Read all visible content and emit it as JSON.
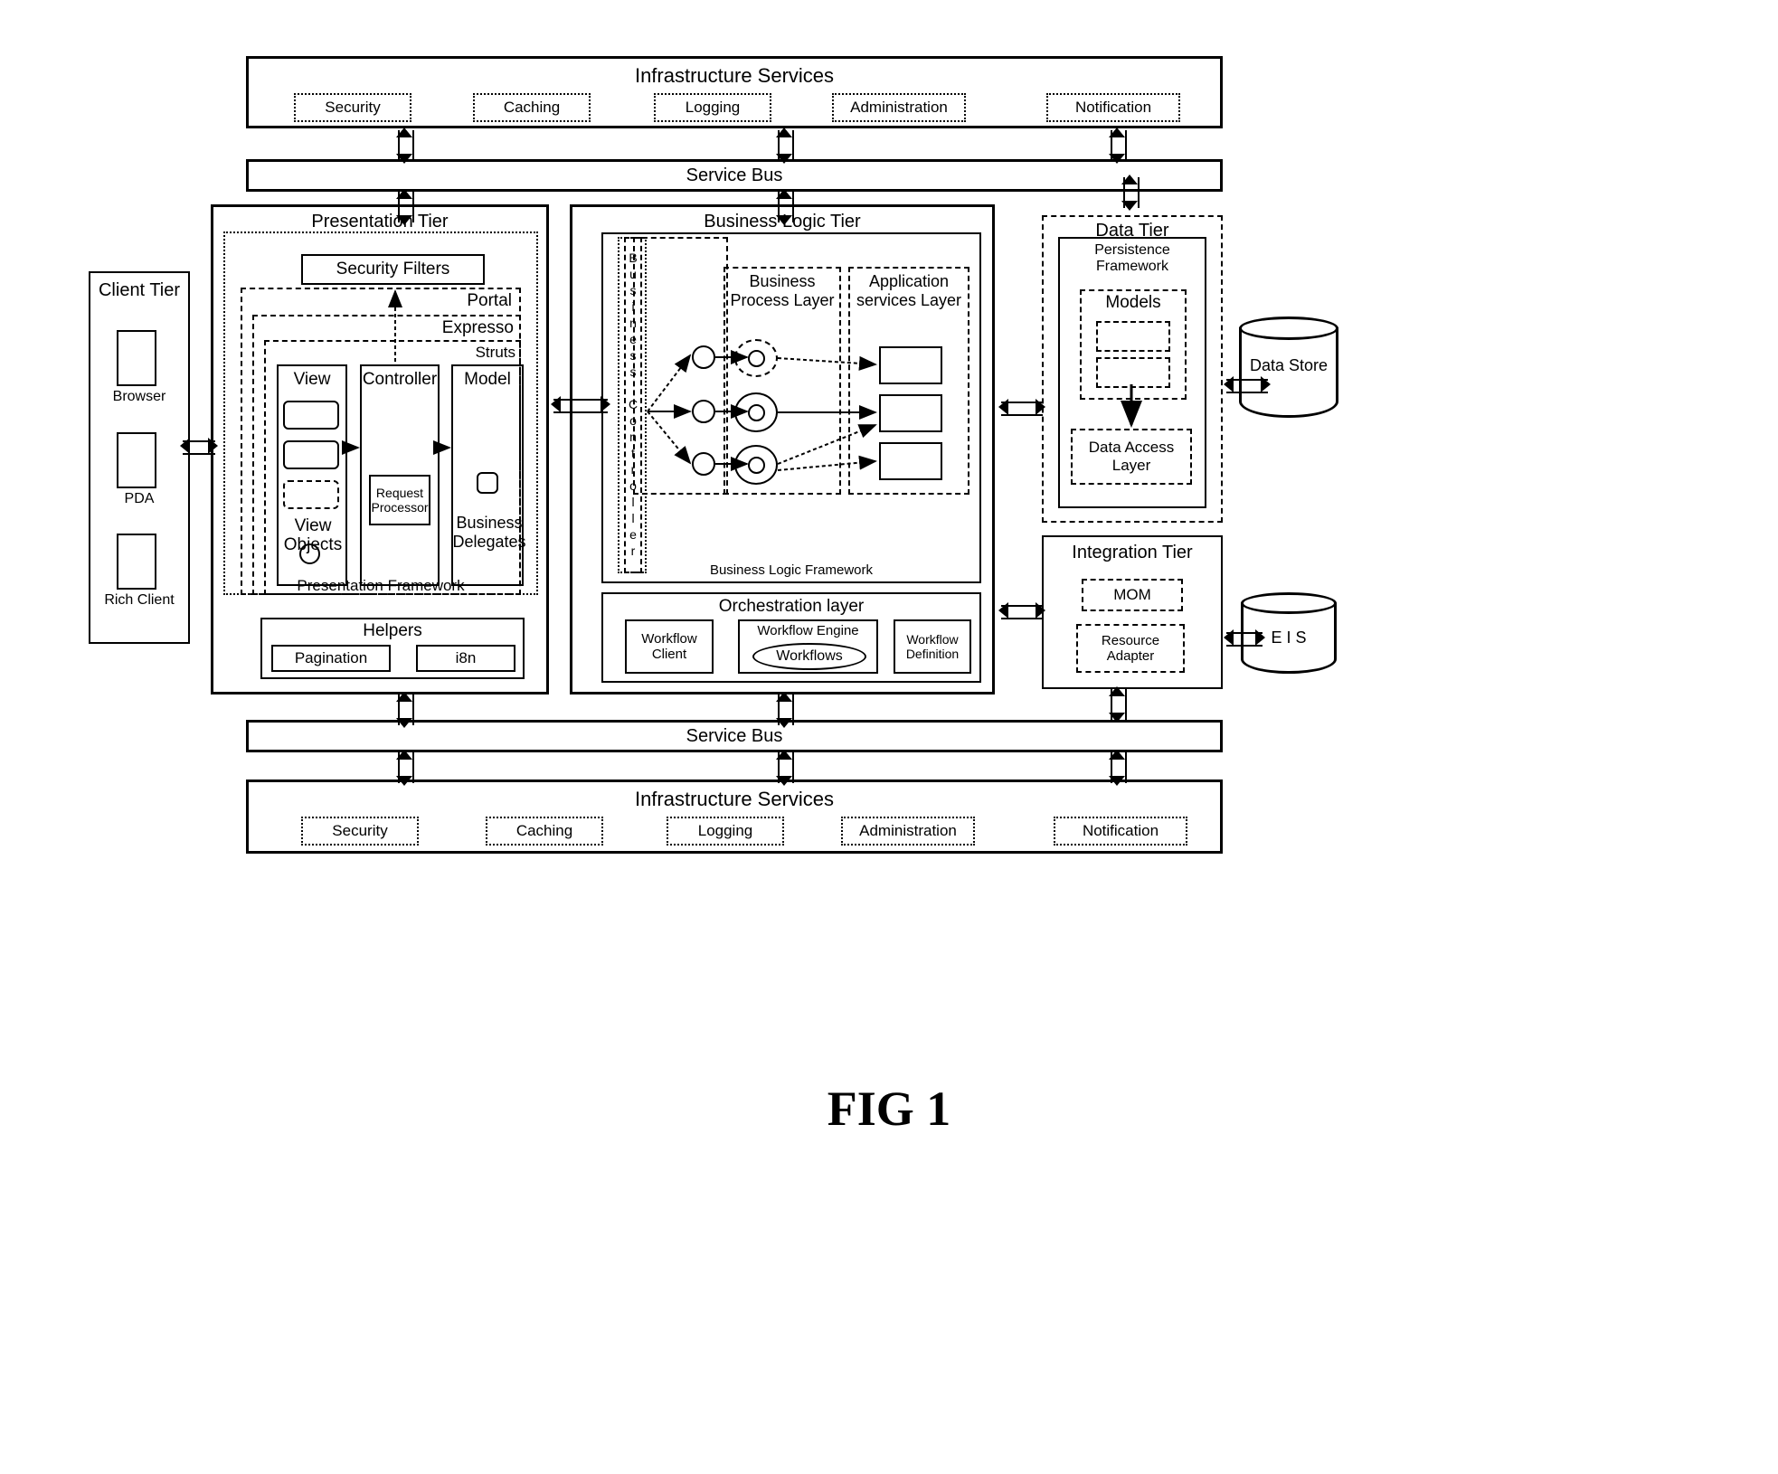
{
  "figure": {
    "caption": "FIG 1"
  },
  "infra_top": {
    "title": "Infrastructure Services",
    "items": [
      "Security",
      "Caching",
      "Logging",
      "Administration",
      "Notification"
    ]
  },
  "service_bus_top": {
    "label": "Service Bus"
  },
  "service_bus_bottom": {
    "label": "Service Bus"
  },
  "infra_bottom": {
    "title": "Infrastructure Services",
    "items": [
      "Security",
      "Caching",
      "Logging",
      "Administration",
      "Notification"
    ]
  },
  "client_tier": {
    "title": "Client Tier",
    "items": [
      "Browser",
      "PDA",
      "Rich Client"
    ]
  },
  "presentation_tier": {
    "title": "Presentation Tier",
    "security_filters": "Security Filters",
    "frameworks": [
      "Portal",
      "Expresso",
      "Struts"
    ],
    "framework_label": "Presentation Framework",
    "view": {
      "title": "View",
      "sub_title": "View Objects",
      "boxes": [
        "",
        "",
        ""
      ]
    },
    "controller": {
      "title": "Controller",
      "request_processor": "Request Processor"
    },
    "model": {
      "title": "Model",
      "business_delegates": "Business Delegates"
    },
    "helpers": {
      "title": "Helpers",
      "items": [
        "Pagination",
        "i8n"
      ]
    }
  },
  "business_logic_tier": {
    "title": "Business Logic Tier",
    "framework_label": "Business Logic Framework",
    "business_controller": "Business Controller",
    "business_process_layer": "Business Process Layer",
    "application_services_layer": "Application services Layer",
    "orchestration": {
      "title": "Orchestration layer",
      "workflow_client": "Workflow Client",
      "workflow_engine": "Workflow Engine",
      "workflows": "Workflows",
      "workflow_definition": "Workflow Definition"
    }
  },
  "data_tier": {
    "title": "Data Tier",
    "persistence_framework": "Persistence Framework",
    "models": "Models",
    "data_access_layer": "Data Access Layer"
  },
  "integration_tier": {
    "title": "Integration Tier",
    "items": [
      "MOM",
      "Resource Adapter"
    ]
  },
  "stores": {
    "data_store": "Data Store",
    "eis": "E I S"
  }
}
